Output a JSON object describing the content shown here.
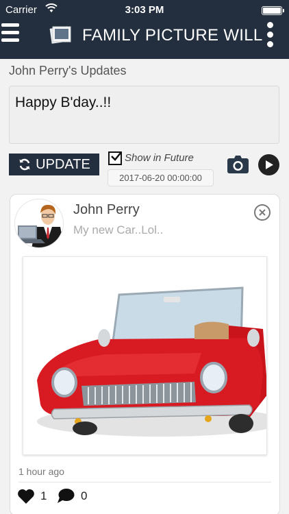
{
  "status_bar": {
    "carrier": "Carrier",
    "time": "3:03 PM",
    "battery_level": 1.0
  },
  "nav_bar": {
    "title": "FAMILY PICTURE WILL",
    "menu_icon": "hamburger-menu-icon",
    "logo_icon": "photo-frame-icon",
    "more_icon": "kebab-menu-icon",
    "background_color": "#232f3e"
  },
  "composer": {
    "section_title": "John Perry's Updates",
    "status_text": "Happy B'day..!!",
    "update_label": "UPDATE",
    "update_icon": "refresh-icon",
    "show_in_future_label": "Show in Future",
    "show_in_future_checked": true,
    "future_date": "2017-06-20 00:00:00",
    "camera_icon": "camera-icon",
    "play_icon": "play-circle-icon"
  },
  "post": {
    "author": "John Perry",
    "text": "My new Car..Lol..",
    "avatar_icon": "businessman-avatar",
    "image_icon": "red-convertible-car-image",
    "close_icon": "close-circle-icon",
    "timestamp": "1 hour ago",
    "likes": "1",
    "comments": "0",
    "like_icon": "heart-icon",
    "comment_icon": "speech-bubble-icon"
  }
}
